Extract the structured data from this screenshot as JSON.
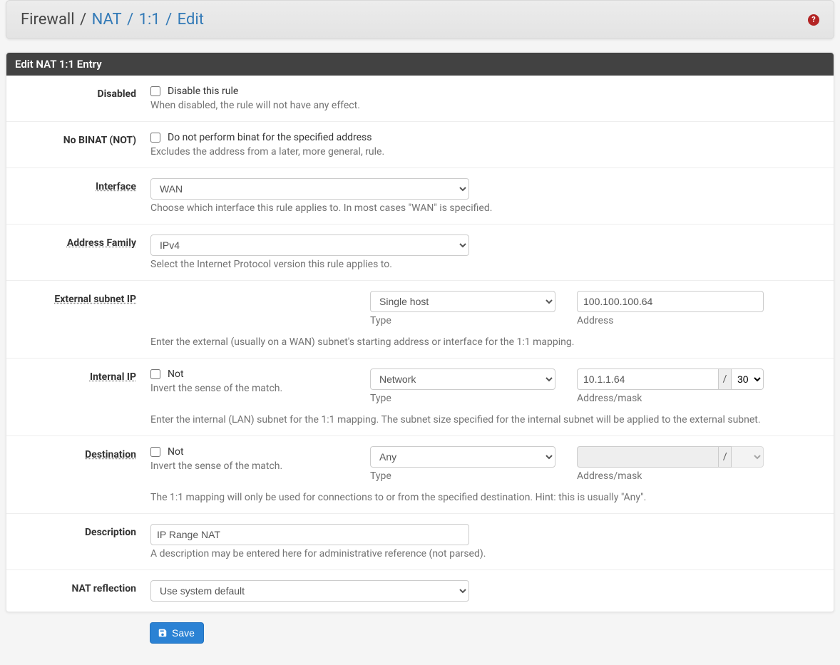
{
  "breadcrumb": {
    "root": "Firewall",
    "items": [
      "NAT",
      "1:1",
      "Edit"
    ]
  },
  "panel_title": "Edit NAT 1:1 Entry",
  "fields": {
    "disabled": {
      "label": "Disabled",
      "cb_label": "Disable this rule",
      "help": "When disabled, the rule will not have any effect.",
      "checked": false
    },
    "nobinat": {
      "label": "No BINAT (NOT)",
      "cb_label": "Do not perform binat for the specified address",
      "help": "Excludes the address from a later, more general, rule.",
      "checked": false
    },
    "interface": {
      "label": "Interface",
      "value": "WAN",
      "help": "Choose which interface this rule applies to. In most cases \"WAN\" is specified."
    },
    "addrfamily": {
      "label": "Address Family",
      "value": "IPv4",
      "help": "Select the Internet Protocol version this rule applies to."
    },
    "external": {
      "label": "External subnet IP",
      "type_label": "Type",
      "type_value": "Single host",
      "addr_label": "Address",
      "address": "100.100.100.64",
      "help": "Enter the external (usually on a WAN) subnet's starting address or interface for the 1:1 mapping."
    },
    "internal": {
      "label": "Internal IP",
      "not_label": "Not",
      "not_help": "Invert the sense of the match.",
      "not_checked": false,
      "type_label": "Type",
      "type_value": "Network",
      "addr_label": "Address/mask",
      "address": "10.1.1.64",
      "mask": "30",
      "help": "Enter the internal (LAN) subnet for the 1:1 mapping. The subnet size specified for the internal subnet will be applied to the external subnet."
    },
    "destination": {
      "label": "Destination",
      "not_label": "Not",
      "not_help": "Invert the sense of the match.",
      "not_checked": false,
      "type_label": "Type",
      "type_value": "Any",
      "addr_label": "Address/mask",
      "address": "",
      "mask": "",
      "help": "The 1:1 mapping will only be used for connections to or from the specified destination. Hint: this is usually \"Any\"."
    },
    "description": {
      "label": "Description",
      "value": "IP Range NAT",
      "help": "A description may be entered here for administrative reference (not parsed)."
    },
    "natreflection": {
      "label": "NAT reflection",
      "value": "Use system default"
    }
  },
  "save_button": "Save",
  "help_icon_text": "?"
}
